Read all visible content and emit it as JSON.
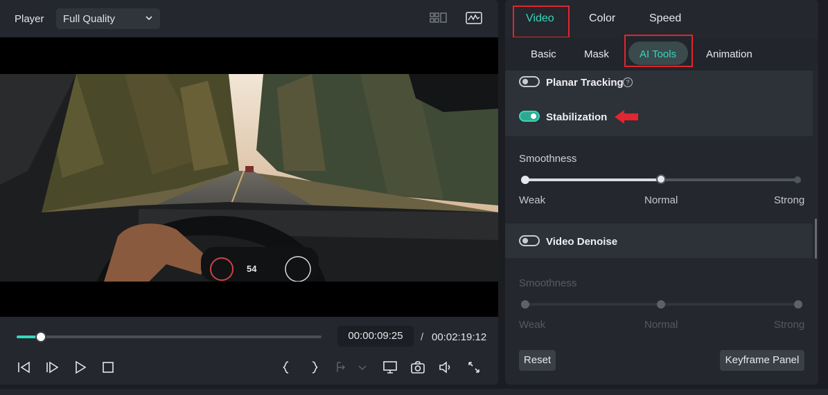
{
  "player": {
    "label": "Player",
    "quality": "Full Quality",
    "progress_fraction": 0.08,
    "current_time": "00:00:09:25",
    "separator": "/",
    "total_time": "00:02:19:12",
    "speedometer": "54"
  },
  "inspector": {
    "tabs": [
      {
        "label": "Video",
        "active": true
      },
      {
        "label": "Color",
        "active": false
      },
      {
        "label": "Speed",
        "active": false
      }
    ],
    "subtabs": [
      {
        "label": "Basic",
        "active": false
      },
      {
        "label": "Mask",
        "active": false
      },
      {
        "label": "AI Tools",
        "active": true
      },
      {
        "label": "Animation",
        "active": false
      }
    ],
    "planar_tracking": {
      "label": "Planar Tracking",
      "enabled": false
    },
    "stabilization": {
      "label": "Stabilization",
      "enabled": true,
      "smoothness_label": "Smoothness",
      "levels": [
        "Weak",
        "Normal",
        "Strong"
      ],
      "selected_level": "Normal"
    },
    "video_denoise": {
      "label": "Video Denoise",
      "enabled": false,
      "smoothness_label": "Smoothness",
      "levels": [
        "Weak",
        "Normal",
        "Strong"
      ],
      "selected_level": "Normal"
    },
    "reset_label": "Reset",
    "keyframe_label": "Keyframe Panel"
  },
  "colors": {
    "accent": "#35d7bd",
    "highlight_box": "#e0262e",
    "panel": "#24272d"
  }
}
